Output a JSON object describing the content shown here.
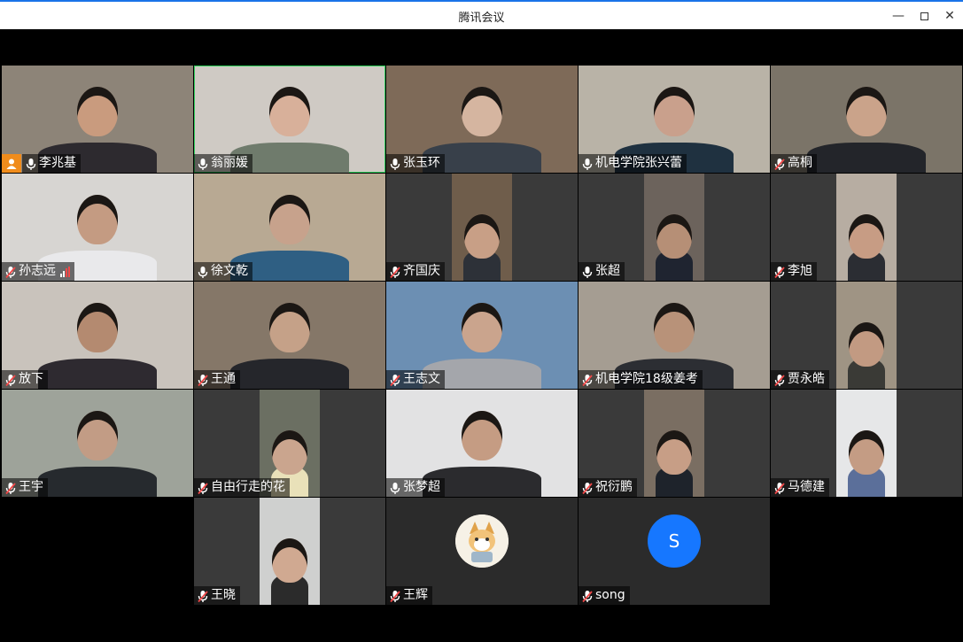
{
  "window": {
    "title": "腾讯会议"
  },
  "participants": [
    {
      "name": "李兆基",
      "mic": "on",
      "host": true
    },
    {
      "name": "翁丽媛",
      "mic": "on",
      "active": true
    },
    {
      "name": "张玉环",
      "mic": "on"
    },
    {
      "name": "机电学院张兴蕾",
      "mic": "on"
    },
    {
      "name": "高桐",
      "mic": "muted"
    },
    {
      "name": "孙志远",
      "mic": "muted",
      "signal": true
    },
    {
      "name": "徐文乾",
      "mic": "on"
    },
    {
      "name": "齐国庆",
      "mic": "muted"
    },
    {
      "name": "张超",
      "mic": "on"
    },
    {
      "name": "李旭",
      "mic": "muted"
    },
    {
      "name": "放下",
      "mic": "muted"
    },
    {
      "name": "王通",
      "mic": "muted"
    },
    {
      "name": "王志文",
      "mic": "muted"
    },
    {
      "name": "机电学院18级姜考",
      "mic": "muted"
    },
    {
      "name": "贾永皓",
      "mic": "muted"
    },
    {
      "name": "王宇",
      "mic": "muted"
    },
    {
      "name": "自由行走的花",
      "mic": "muted"
    },
    {
      "name": "张梦超",
      "mic": "on"
    },
    {
      "name": "祝衍鹏",
      "mic": "muted"
    },
    {
      "name": "马德建",
      "mic": "muted"
    },
    {
      "name": "王晓",
      "mic": "muted"
    },
    {
      "name": "王辉",
      "mic": "muted",
      "avatar": "image"
    },
    {
      "name": "song",
      "mic": "muted",
      "avatar": "S"
    }
  ]
}
